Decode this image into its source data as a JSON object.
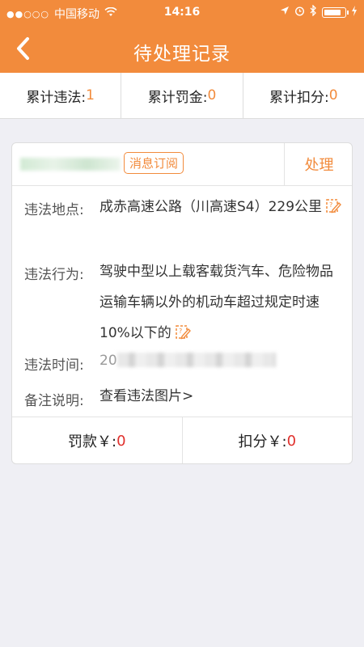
{
  "status_bar": {
    "carrier": "中国移动",
    "time": "14:16"
  },
  "nav": {
    "title": "待处理记录"
  },
  "summary": {
    "violations_label": "累计违法:",
    "violations_value": "1",
    "fines_label": "累计罚金:",
    "fines_value": "0",
    "points_label": "累计扣分:",
    "points_value": "0"
  },
  "card": {
    "subscribe_label": "消息订阅",
    "process_label": "处理",
    "location_label": "违法地点:",
    "location_value": "成赤高速公路（川高速S4）229公里",
    "behavior_label": "违法行为:",
    "behavior_value": "驾驶中型以上载客载货汽车、危险物品运输车辆以外的机动车超过规定时速10%以下的",
    "time_label": "违法时间:",
    "time_visible_prefix": "20",
    "remark_label": "备注说明:",
    "remark_link": "查看违法图片>",
    "fine_label": "罚款￥:",
    "fine_value": "0",
    "points_label": "扣分￥:",
    "points_value": "0"
  },
  "colors": {
    "accent": "#f28b3c",
    "value_red": "#e0302c"
  },
  "icons": [
    "signal-dots-icon",
    "wifi-icon",
    "location-icon",
    "alarm-icon",
    "bluetooth-icon",
    "battery-icon",
    "back-chevron-icon",
    "edit-icon"
  ]
}
